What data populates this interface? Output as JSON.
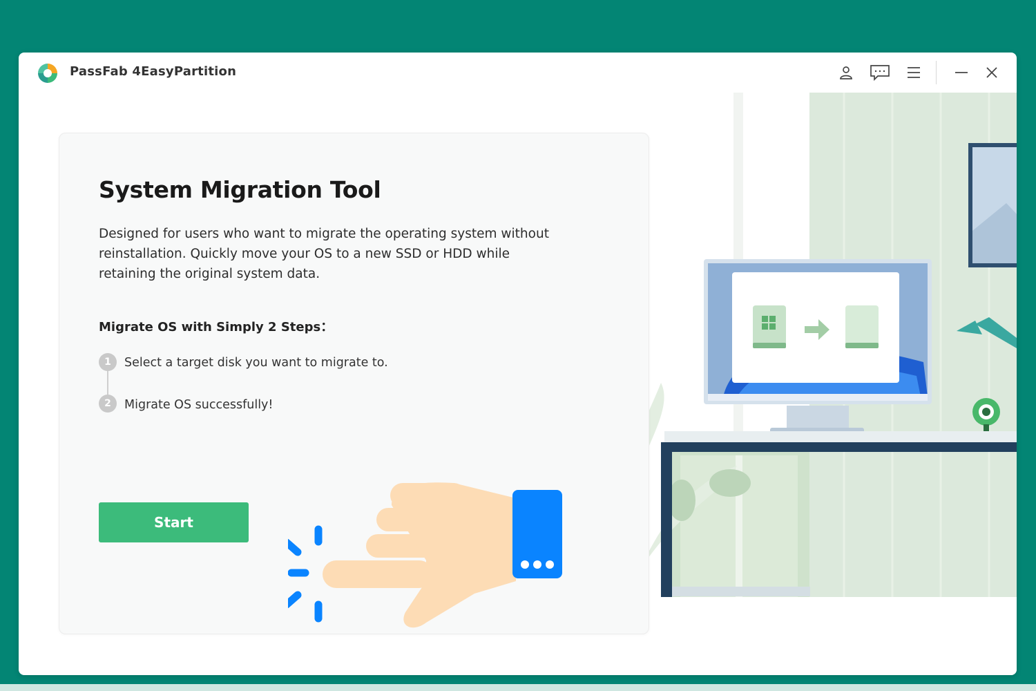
{
  "app": {
    "title": "PassFab 4EasyPartition"
  },
  "titlebar": {
    "icons": [
      "user-icon",
      "feedback-icon",
      "menu-icon",
      "minimize-icon",
      "close-icon"
    ]
  },
  "main": {
    "title": "System Migration Tool",
    "description": "Designed for users who want to migrate the operating system without reinstallation. Quickly move your OS to a new SSD or HDD while retaining the original system data.",
    "steps_heading": "Migrate OS with Simply 2 Steps：",
    "steps": [
      {
        "number": "1",
        "text": "Select a target disk you want to migrate to."
      },
      {
        "number": "2",
        "text": "Migrate OS successfully!"
      }
    ],
    "start_label": "Start"
  },
  "colors": {
    "background": "#038574",
    "accent_green": "#3cbb7b",
    "pointer_blue": "#0a84ff",
    "hand_skin": "#fddcb5"
  }
}
